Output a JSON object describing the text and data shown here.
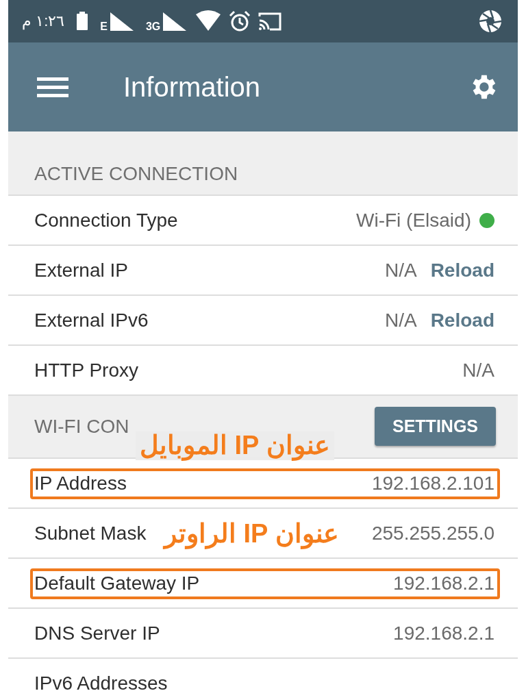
{
  "status_bar": {
    "time": "١:٢٦ م",
    "network_labels": [
      "E",
      "3G"
    ]
  },
  "app_bar": {
    "title": "Information"
  },
  "sections": [
    {
      "title": "ACTIVE CONNECTION",
      "rows": [
        {
          "kind": "status",
          "label": "Connection Type",
          "value": "Wi-Fi (Elsaid)",
          "color": "#3fae49",
          "highlighted": false
        },
        {
          "kind": "reload",
          "label": "External IP",
          "value": "N/A",
          "action": "Reload",
          "highlighted": false
        },
        {
          "kind": "reload",
          "label": "External IPv6",
          "value": "N/A",
          "action": "Reload",
          "highlighted": false
        },
        {
          "kind": "plain",
          "label": "HTTP Proxy",
          "value": "N/A",
          "highlighted": false
        }
      ]
    },
    {
      "title": "WI-FI CON",
      "button": "SETTINGS",
      "annotation": "عنوان IP الموبايل",
      "rows": [
        {
          "kind": "plain",
          "label": "IP Address",
          "value": "192.168.2.101",
          "highlighted": true
        },
        {
          "kind": "plain",
          "label": "Subnet Mask",
          "value": "255.255.255.0",
          "highlighted": false,
          "annotation": "عنوان IP الراوتر"
        },
        {
          "kind": "plain",
          "label": "Default Gateway IP",
          "value": "192.168.2.1",
          "highlighted": true
        },
        {
          "kind": "plain",
          "label": "DNS Server IP",
          "value": "192.168.2.1",
          "highlighted": false
        },
        {
          "kind": "plain",
          "label": "IPv6 Addresses",
          "highlighted": false
        }
      ]
    }
  ]
}
